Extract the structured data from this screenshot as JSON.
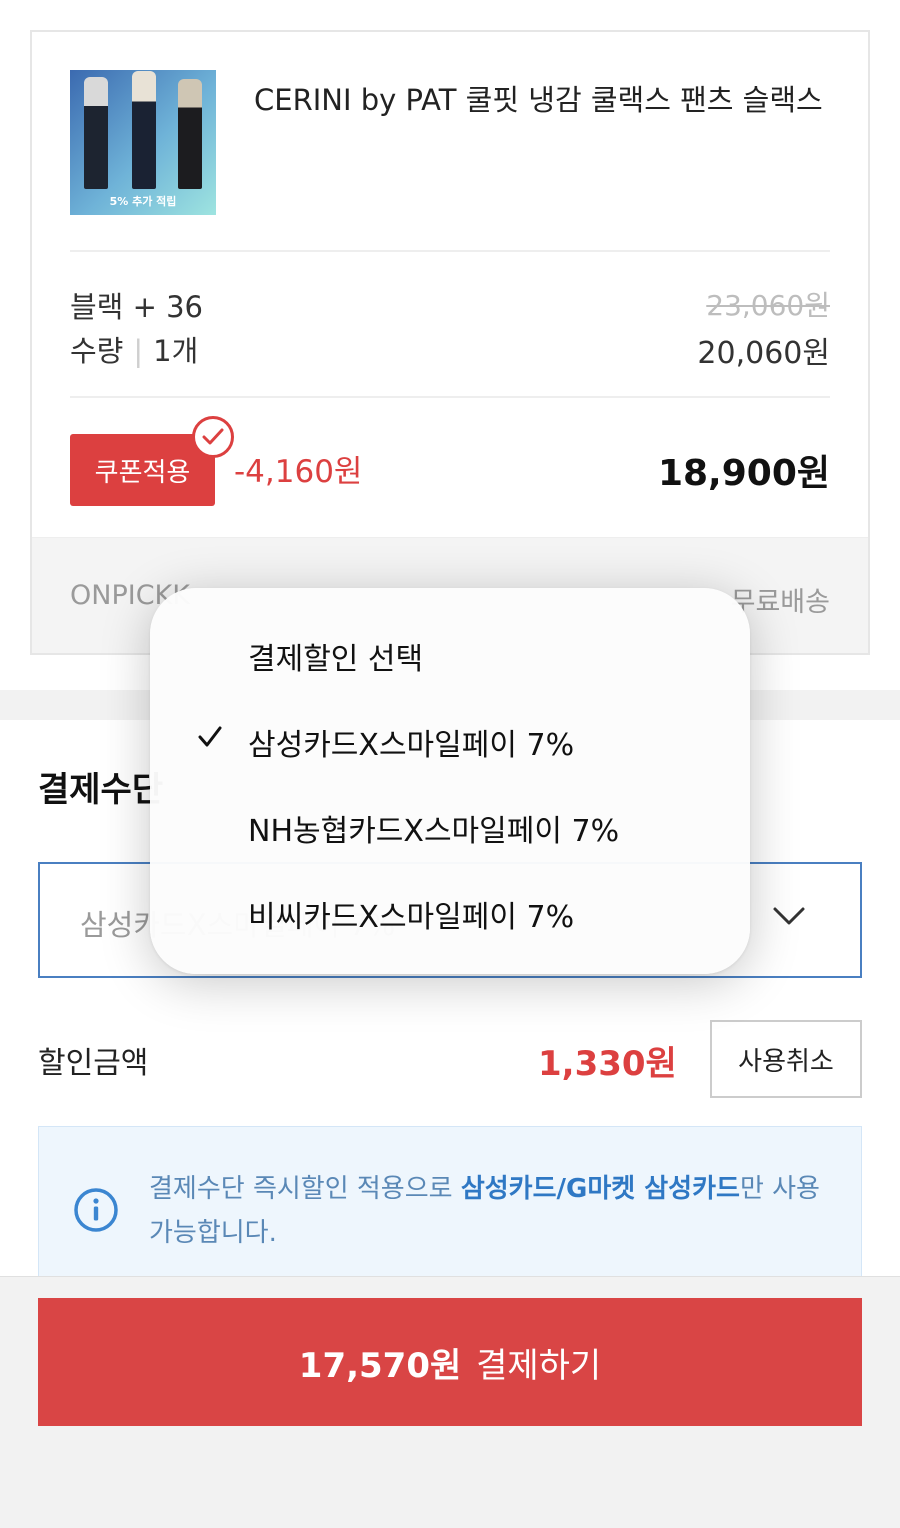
{
  "product": {
    "image_tag": "5% 추가 적립",
    "title": "CERINI by PAT 쿨핏 냉감 쿨랙스 팬츠 슬랙스",
    "option": "블랙 + 36",
    "quantity_label": "수량",
    "quantity_value": "1개",
    "original_price": "23,060원",
    "price": "20,060원",
    "coupon_button": "쿠폰적용",
    "coupon_discount": "-4,160원",
    "final_price": "18,900원",
    "seller": "ONPICKK",
    "shipping": "무료배송"
  },
  "payment": {
    "section_title": "결제수단",
    "select_value": "삼성카드X스마일페이 7%",
    "discount_label": "할인금액",
    "discount_amount": "1,330원",
    "cancel_button": "사용취소",
    "notice_prefix": "결제수단 즉시할인 적용으로 ",
    "notice_bold": "삼성카드/G마켓 삼성카드",
    "notice_suffix": "만 사용 가능합니다."
  },
  "checkout": {
    "amount": "17,570원",
    "label": "결제하기"
  },
  "dropdown": {
    "header": "결제할인 선택",
    "options": [
      {
        "label": "삼성카드X스마일페이 7%",
        "selected": true
      },
      {
        "label": "NH농협카드X스마일페이 7%",
        "selected": false
      },
      {
        "label": "비씨카드X스마일페이 7%",
        "selected": false
      }
    ]
  },
  "icons": {
    "checkmark": "checkmark-icon",
    "coupon_check": "check-circle-icon",
    "chevron": "chevron-down-icon",
    "info": "info-icon"
  },
  "colors": {
    "accent_red": "#dc4040",
    "select_border": "#4a7fc1",
    "notice_bg": "#eef6fd",
    "notice_text": "#5a88b6",
    "notice_highlight": "#2f78c4"
  }
}
